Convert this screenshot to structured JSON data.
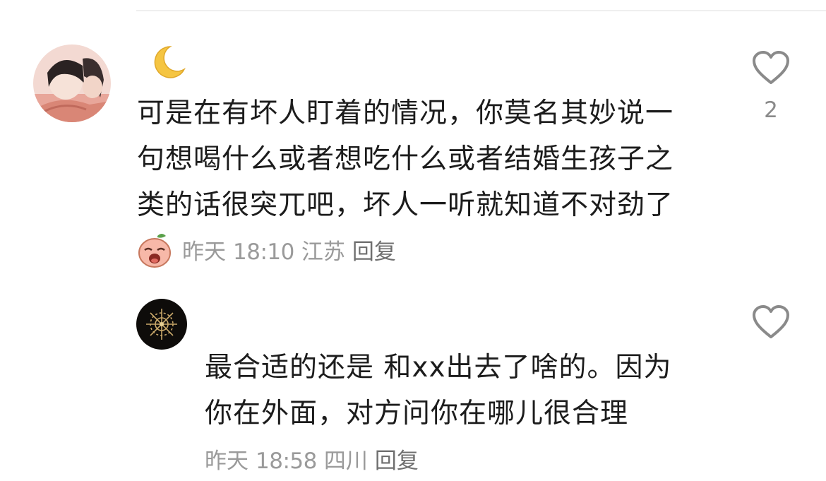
{
  "comments": [
    {
      "nickname_icon": "crescent-moon-emoji",
      "text_lines": [
        "可是在有坏人盯着的情况，你莫名其妙说一",
        "句想喝什么或者想吃什么或者结婚生孩子之",
        "类的话很突兀吧，坏人一听就知道不对劲了"
      ],
      "date": "昨天",
      "time": "18:10",
      "location": "江苏",
      "reply_label": "回复",
      "like_count": "2",
      "badge_icon": "crying-face-sticker"
    },
    {
      "text_lines": [
        "最合适的还是 和xx出去了啥的。因为",
        "你在外面，对方问你在哪儿很合理"
      ],
      "date": "昨天",
      "time": "18:58",
      "location": "四川",
      "reply_label": "回复"
    }
  ],
  "colors": {
    "text": "#1c1c1c",
    "meta": "#9a9a9a",
    "icon": "#8a8a8a"
  }
}
